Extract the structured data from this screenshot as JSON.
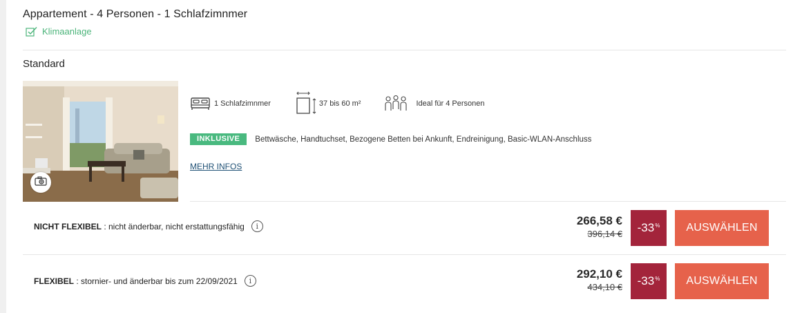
{
  "room": {
    "title": "Appartement - 4 Personen - 1 Schlafzimnmer",
    "amenity": "Klimaanlage",
    "rate_name": "Standard",
    "features": [
      {
        "icon": "bed-icon",
        "label": "1 Schlafzimnmer"
      },
      {
        "icon": "area-icon",
        "label": "37 bis 60 m²"
      },
      {
        "icon": "people-icon",
        "label": "Ideal für 4 Personen"
      }
    ],
    "inclusive": {
      "badge": "INKLUSIVE",
      "text": "Bettwäsche, Handtuchset, Bezogene Betten bei Ankunft, Endreinigung, Basic-WLAN-Anschluss"
    },
    "more_info": "MEHR INFOS"
  },
  "rates": [
    {
      "name": "NICHT FLEXIBEL",
      "description": " : nicht änderbar, nicht erstattungsfähig",
      "info_icon": "i",
      "price": "266,58 €",
      "old_price": "396,14 €",
      "discount": "-33",
      "discount_unit": "%",
      "button": "AUSWÄHLEN"
    },
    {
      "name": "FLEXIBEL",
      "description": " : stornier- und änderbar bis zum 22/09/2021",
      "info_icon": "i",
      "price": "292,10 €",
      "old_price": "434,10 €",
      "discount": "-33",
      "discount_unit": "%",
      "button": "AUSWÄHLEN"
    }
  ],
  "colors": {
    "amenity_green": "#4bb47a",
    "inclusive_badge": "#49b97f",
    "discount_bg": "#a3243b",
    "button_bg": "#e6624b",
    "link": "#1d4f74"
  }
}
